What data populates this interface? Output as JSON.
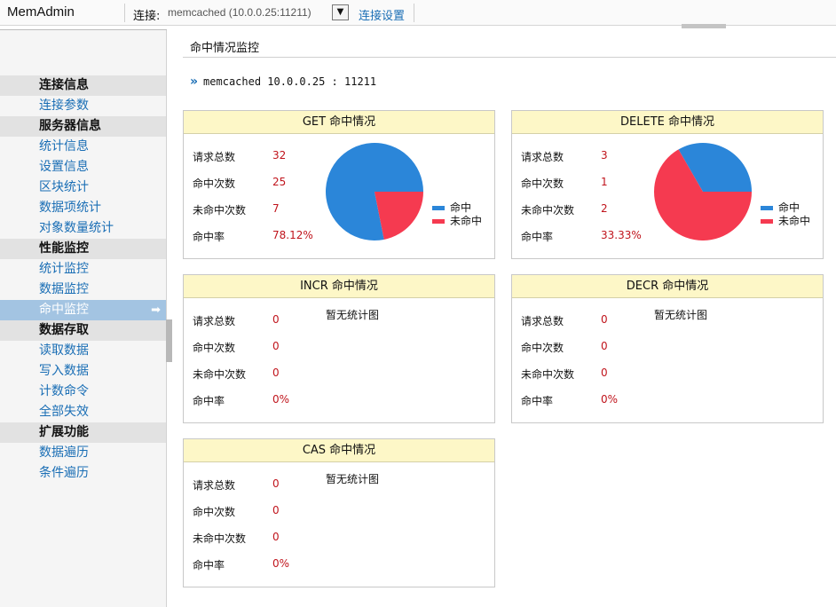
{
  "app": {
    "title": "MemAdmin"
  },
  "connection": {
    "label": "连接:",
    "value": "memcached (10.0.0.25:11211)",
    "dropdown_glyph": "▼",
    "settings_label": "连接设置"
  },
  "sidebar": {
    "groups": [
      {
        "header": "连接信息",
        "items": [
          "连接参数"
        ]
      },
      {
        "header": "服务器信息",
        "items": [
          "统计信息",
          "设置信息",
          "区块统计",
          "数据项统计",
          "对象数量统计"
        ]
      },
      {
        "header": "性能监控",
        "items": [
          "统计监控",
          "数据监控",
          "命中监控"
        ]
      },
      {
        "header": "数据存取",
        "items": [
          "读取数据",
          "写入数据",
          "计数命令",
          "全部失效"
        ]
      },
      {
        "header": "扩展功能",
        "items": [
          "数据遍历",
          "条件遍历"
        ]
      }
    ],
    "active_item": "命中监控",
    "active_arrow_glyph": "➡"
  },
  "main": {
    "page_title": "命中情况监控",
    "server_chevron": "»",
    "server": "memcached  10.0.0.25 : 11211",
    "row_labels": [
      "请求总数",
      "命中次数",
      "未命中次数",
      "命中率"
    ],
    "no_chart_text": "暂无统计图",
    "panels": [
      {
        "key": "get",
        "title": "GET 命中情况",
        "values": [
          "32",
          "25",
          "7",
          "78.12%"
        ],
        "has_chart": true
      },
      {
        "key": "delete",
        "title": "DELETE 命中情况",
        "values": [
          "3",
          "1",
          "2",
          "33.33%"
        ],
        "has_chart": true
      },
      {
        "key": "incr",
        "title": "INCR 命中情况",
        "values": [
          "0",
          "0",
          "0",
          "0%"
        ],
        "has_chart": false
      },
      {
        "key": "decr",
        "title": "DECR 命中情况",
        "values": [
          "0",
          "0",
          "0",
          "0%"
        ],
        "has_chart": false
      },
      {
        "key": "cas",
        "title": "CAS 命中情况",
        "values": [
          "0",
          "0",
          "0",
          "0%"
        ],
        "has_chart": false
      }
    ]
  },
  "chart_data": [
    {
      "type": "pie",
      "labels": [
        "命中",
        "未命中"
      ],
      "values": [
        25,
        7
      ],
      "colors": [
        "#2b86d9",
        "#f53a50"
      ]
    },
    {
      "type": "pie",
      "labels": [
        "命中",
        "未命中"
      ],
      "values": [
        1,
        2
      ],
      "colors": [
        "#2b86d9",
        "#f53a50"
      ]
    }
  ]
}
